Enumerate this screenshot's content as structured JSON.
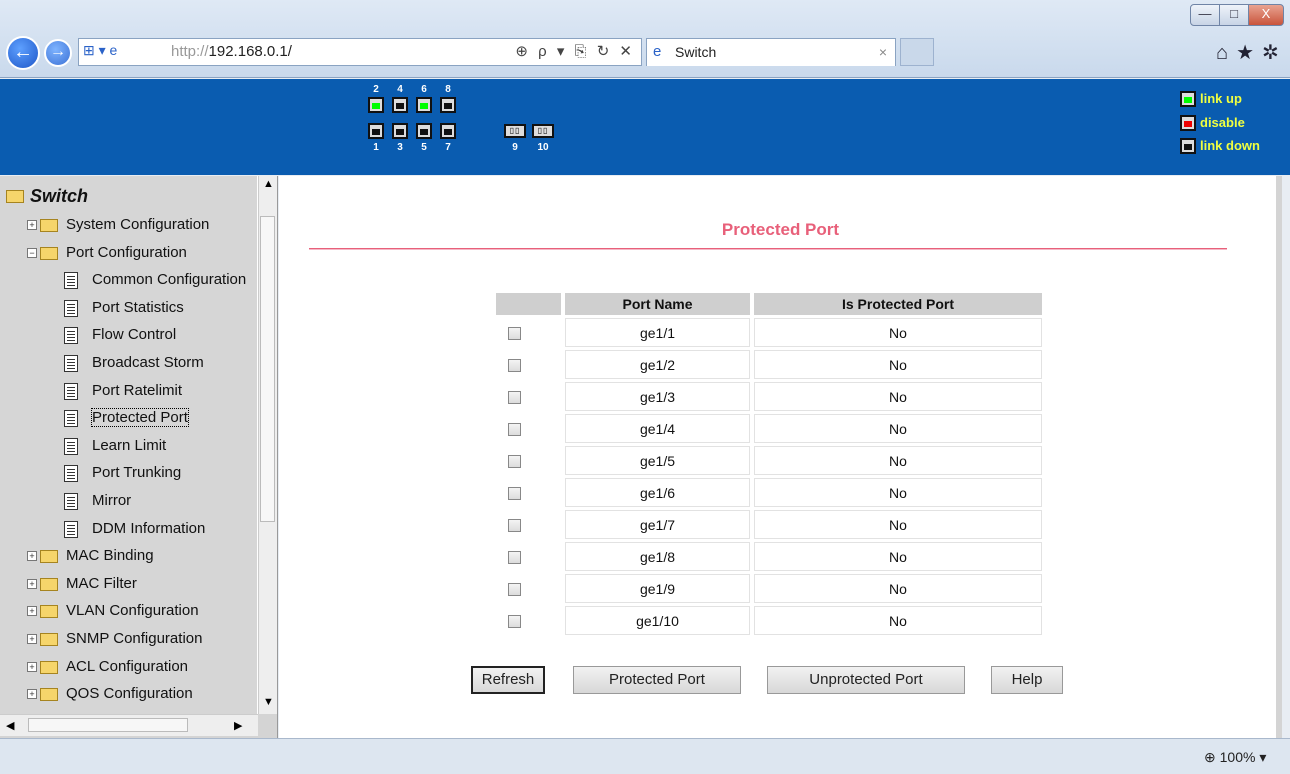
{
  "window": {
    "min": "—",
    "max": "□",
    "close": "X"
  },
  "address": {
    "prefix": "http://",
    "url": "192.168.0.1/",
    "tools": "⊕ ρ ▾ ⎘ ↻ ✕"
  },
  "tab": {
    "title": "Switch",
    "close": "×"
  },
  "toolbar_icons": [
    "home-icon",
    "star-icon",
    "gear-icon"
  ],
  "header": {
    "ports_top": [
      {
        "num": "2",
        "state": "up"
      },
      {
        "num": "4",
        "state": "down"
      },
      {
        "num": "6",
        "state": "up"
      },
      {
        "num": "8",
        "state": "down"
      }
    ],
    "ports_bottom": [
      {
        "num": "1",
        "state": "down"
      },
      {
        "num": "3",
        "state": "down"
      },
      {
        "num": "5",
        "state": "down"
      },
      {
        "num": "7",
        "state": "down"
      }
    ],
    "fiber_ports": [
      {
        "num": "9"
      },
      {
        "num": "10"
      }
    ],
    "legend": {
      "up": "link up",
      "disable": "disable",
      "down": "link down"
    },
    "colors": {
      "banner": "#0a5cb0",
      "legend_text": "#f0ff40"
    }
  },
  "sidebar": {
    "root": "Switch",
    "items": [
      {
        "label": "System Configuration",
        "type": "folder",
        "expanded": false
      },
      {
        "label": "Port Configuration",
        "type": "folder",
        "expanded": true
      },
      {
        "label": "Common Configuration",
        "type": "page"
      },
      {
        "label": "Port Statistics",
        "type": "page"
      },
      {
        "label": "Flow Control",
        "type": "page"
      },
      {
        "label": "Broadcast Storm",
        "type": "page"
      },
      {
        "label": "Port Ratelimit",
        "type": "page"
      },
      {
        "label": "Protected Port",
        "type": "page",
        "selected": true
      },
      {
        "label": "Learn Limit",
        "type": "page"
      },
      {
        "label": "Port Trunking",
        "type": "page"
      },
      {
        "label": "Mirror",
        "type": "page"
      },
      {
        "label": "DDM Information",
        "type": "page"
      },
      {
        "label": "MAC Binding",
        "type": "folder",
        "expanded": false
      },
      {
        "label": "MAC Filter",
        "type": "folder",
        "expanded": false
      },
      {
        "label": "VLAN Configuration",
        "type": "folder",
        "expanded": false
      },
      {
        "label": "SNMP Configuration",
        "type": "folder",
        "expanded": false
      },
      {
        "label": "ACL Configuration",
        "type": "folder",
        "expanded": false
      },
      {
        "label": "QOS Configuration",
        "type": "folder",
        "expanded": false
      }
    ]
  },
  "main": {
    "title": "Protected Port",
    "table": {
      "headers": [
        "",
        "Port Name",
        "Is Protected Port"
      ],
      "rows": [
        {
          "port": "ge1/1",
          "protected": "No",
          "checked": false
        },
        {
          "port": "ge1/2",
          "protected": "No",
          "checked": false
        },
        {
          "port": "ge1/3",
          "protected": "No",
          "checked": false
        },
        {
          "port": "ge1/4",
          "protected": "No",
          "checked": false
        },
        {
          "port": "ge1/5",
          "protected": "No",
          "checked": false
        },
        {
          "port": "ge1/6",
          "protected": "No",
          "checked": false
        },
        {
          "port": "ge1/7",
          "protected": "No",
          "checked": false
        },
        {
          "port": "ge1/8",
          "protected": "No",
          "checked": false
        },
        {
          "port": "ge1/9",
          "protected": "No",
          "checked": false
        },
        {
          "port": "ge1/10",
          "protected": "No",
          "checked": false
        }
      ]
    },
    "buttons": {
      "refresh": "Refresh",
      "protect": "Protected Port",
      "unprotect": "Unprotected Port",
      "help": "Help"
    },
    "accent": "#e8607a"
  },
  "status": {
    "zoom": "100%"
  }
}
